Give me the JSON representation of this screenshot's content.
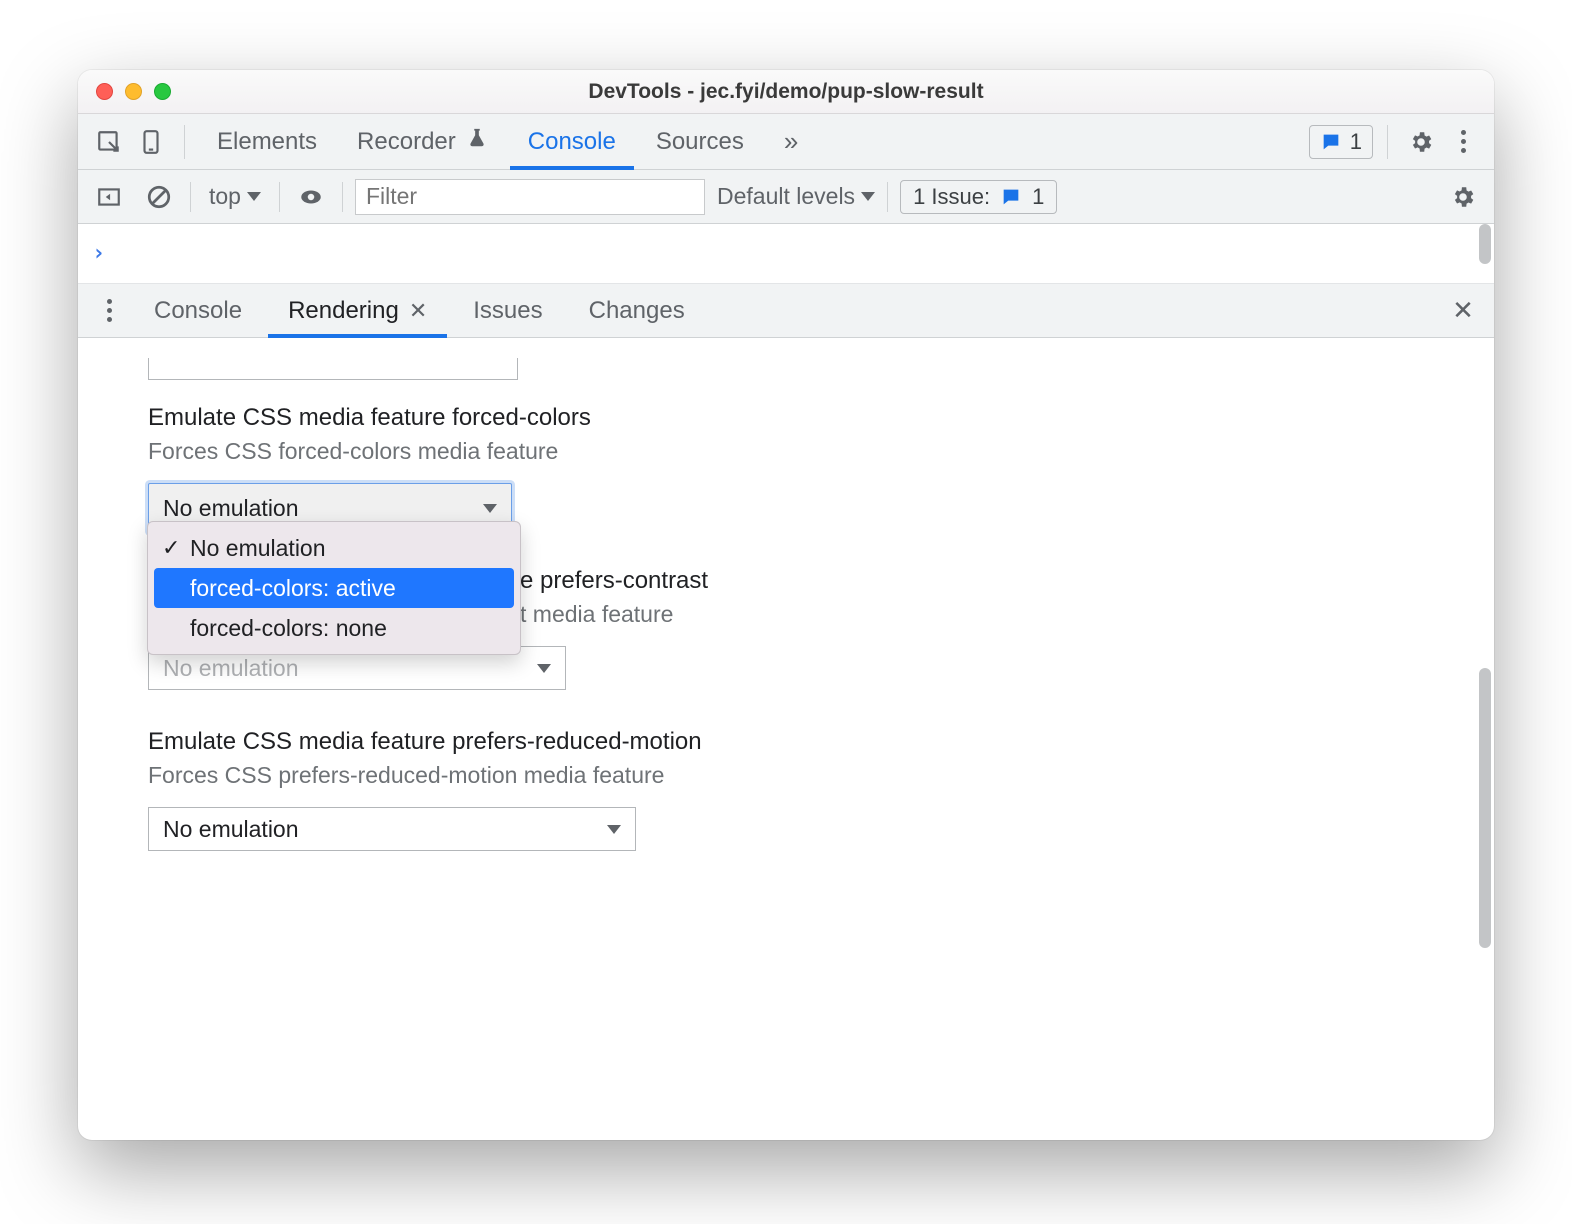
{
  "window": {
    "title": "DevTools - jec.fyi/demo/pup-slow-result"
  },
  "main_tabs": {
    "elements": "Elements",
    "recorder": "Recorder",
    "console": "Console",
    "sources": "Sources",
    "more_glyph": "»",
    "issues_count": "1"
  },
  "console_toolbar": {
    "context": "top",
    "filter_placeholder": "Filter",
    "levels": "Default levels",
    "issues_label": "1 Issue:",
    "issues_count": "1"
  },
  "console_prompt": "›",
  "drawer_tabs": {
    "console": "Console",
    "rendering": "Rendering",
    "issues": "Issues",
    "changes": "Changes"
  },
  "rendering": {
    "forced_colors": {
      "heading": "Emulate CSS media feature forced-colors",
      "sub": "Forces CSS forced-colors media feature",
      "value": "No emulation",
      "options": {
        "none": "No emulation",
        "active": "forced-colors: active",
        "fc_none": "forced-colors: none"
      }
    },
    "prefers_contrast": {
      "heading_suffix": "prefers-contrast",
      "sub_suffix": "t media feature",
      "value": "No emulation"
    },
    "prefers_reduced_motion": {
      "heading": "Emulate CSS media feature prefers-reduced-motion",
      "sub": "Forces CSS prefers-reduced-motion media feature",
      "value": "No emulation"
    }
  }
}
